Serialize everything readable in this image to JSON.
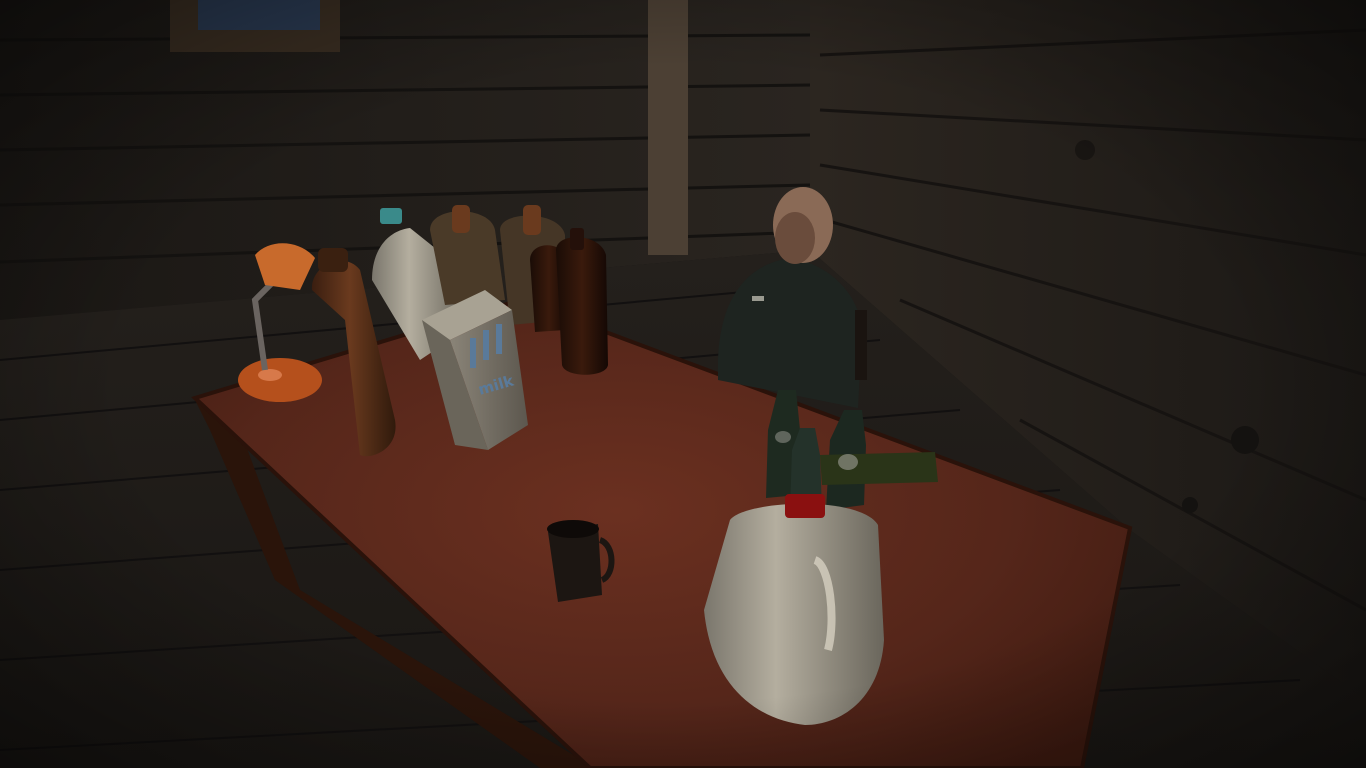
{
  "scene": {
    "description_color_wall": "#2a2520",
    "palette": {
      "wall_dark": "#1c1916",
      "wall_mid": "#2c2722",
      "floor_dark": "#1a1714",
      "floor_mid": "#2a2520",
      "table_top": "#5a2a18",
      "table_edge": "#3a1a0e",
      "lamp_orange": "#b5501c",
      "jug_white": "#b8b2a4",
      "bottle_brown": "#4a2814",
      "cap_red": "#8a1010",
      "cap_teal": "#3a8a8a",
      "npc_shirt": "#1e2420",
      "npc_skin": "#8a6a56"
    },
    "props": {
      "carton_label": "milk",
      "npc": "bald-man-in-dark-shirt"
    }
  }
}
